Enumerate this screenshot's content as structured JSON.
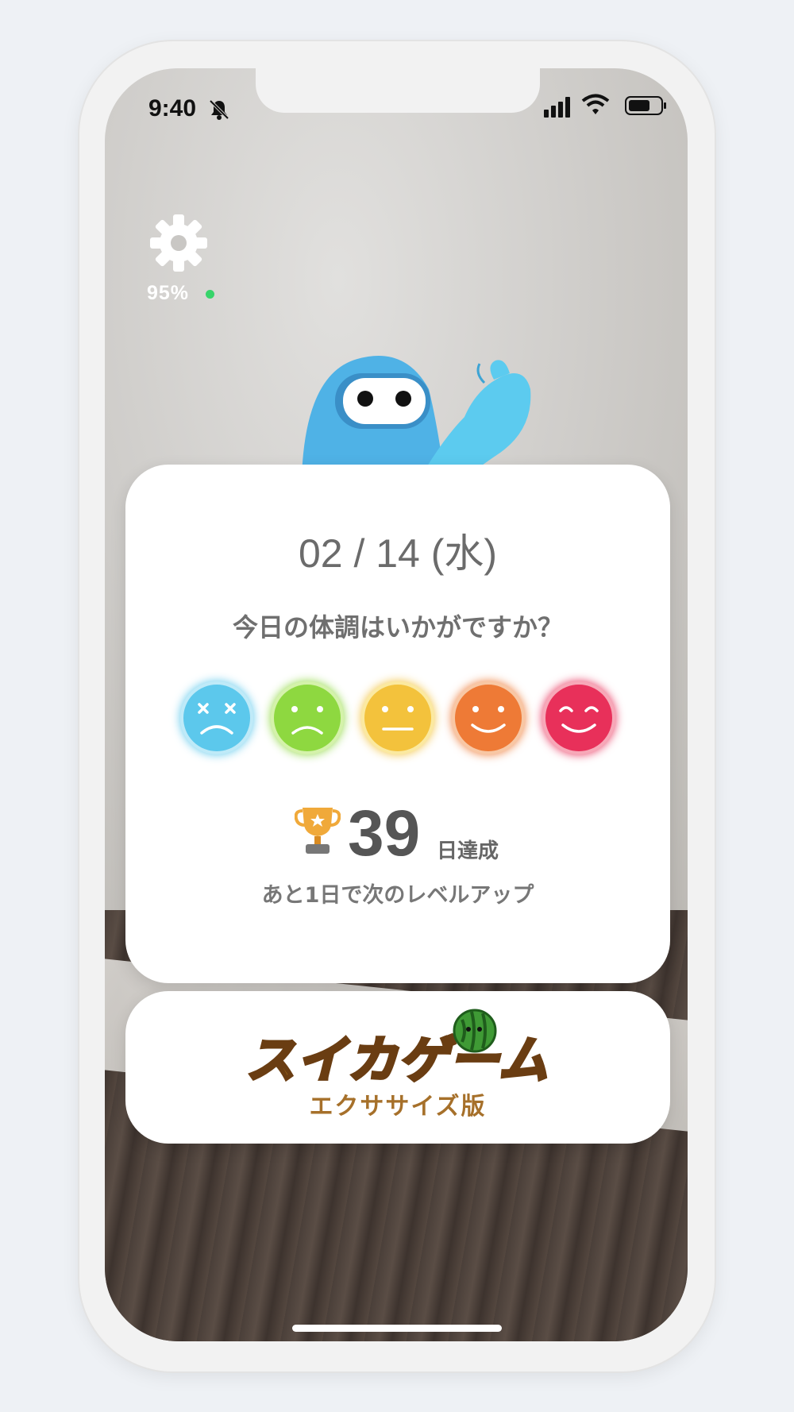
{
  "status": {
    "time": "9:40",
    "bell_icon": "bell-slash-icon",
    "signal_icon": "signal-bars-icon",
    "wifi_icon": "wifi-icon",
    "battery_icon": "battery-icon"
  },
  "settings": {
    "icon": "gear-icon",
    "battery_percent": "95%",
    "connection_dot_color": "#37d46a"
  },
  "mascot": {
    "icon": "blue-ninja-mascot-icon"
  },
  "checkin": {
    "date": "02 / 14 (水)",
    "question": "今日の体調はいかがですか？",
    "faces": [
      {
        "icon": "dizzy-face-icon",
        "color": "#5cc8ec"
      },
      {
        "icon": "sad-face-icon",
        "color": "#8ed840"
      },
      {
        "icon": "neutral-face-icon",
        "color": "#f3c23c"
      },
      {
        "icon": "smile-face-icon",
        "color": "#ee7a36"
      },
      {
        "icon": "happy-face-icon",
        "color": "#e8305a"
      }
    ],
    "streak_icon": "trophy-icon",
    "streak_days": "39",
    "streak_unit": "日達成",
    "next_level": "あと1日で次のレベルアップ"
  },
  "game_banner": {
    "title": "スイカゲーム",
    "subtitle": "エクササイズ版",
    "icon": "watermelon-icon"
  }
}
